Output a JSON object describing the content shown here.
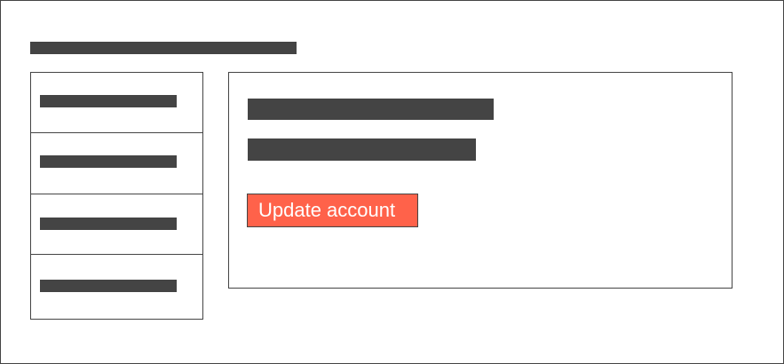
{
  "page": {
    "accent_color": "#ff624a",
    "placeholder_color": "#444444"
  },
  "sidebar": {
    "items": [
      {
        "id": "item-1"
      },
      {
        "id": "item-2"
      },
      {
        "id": "item-3"
      },
      {
        "id": "item-4"
      }
    ]
  },
  "main": {
    "update_button_label": "Update account"
  }
}
